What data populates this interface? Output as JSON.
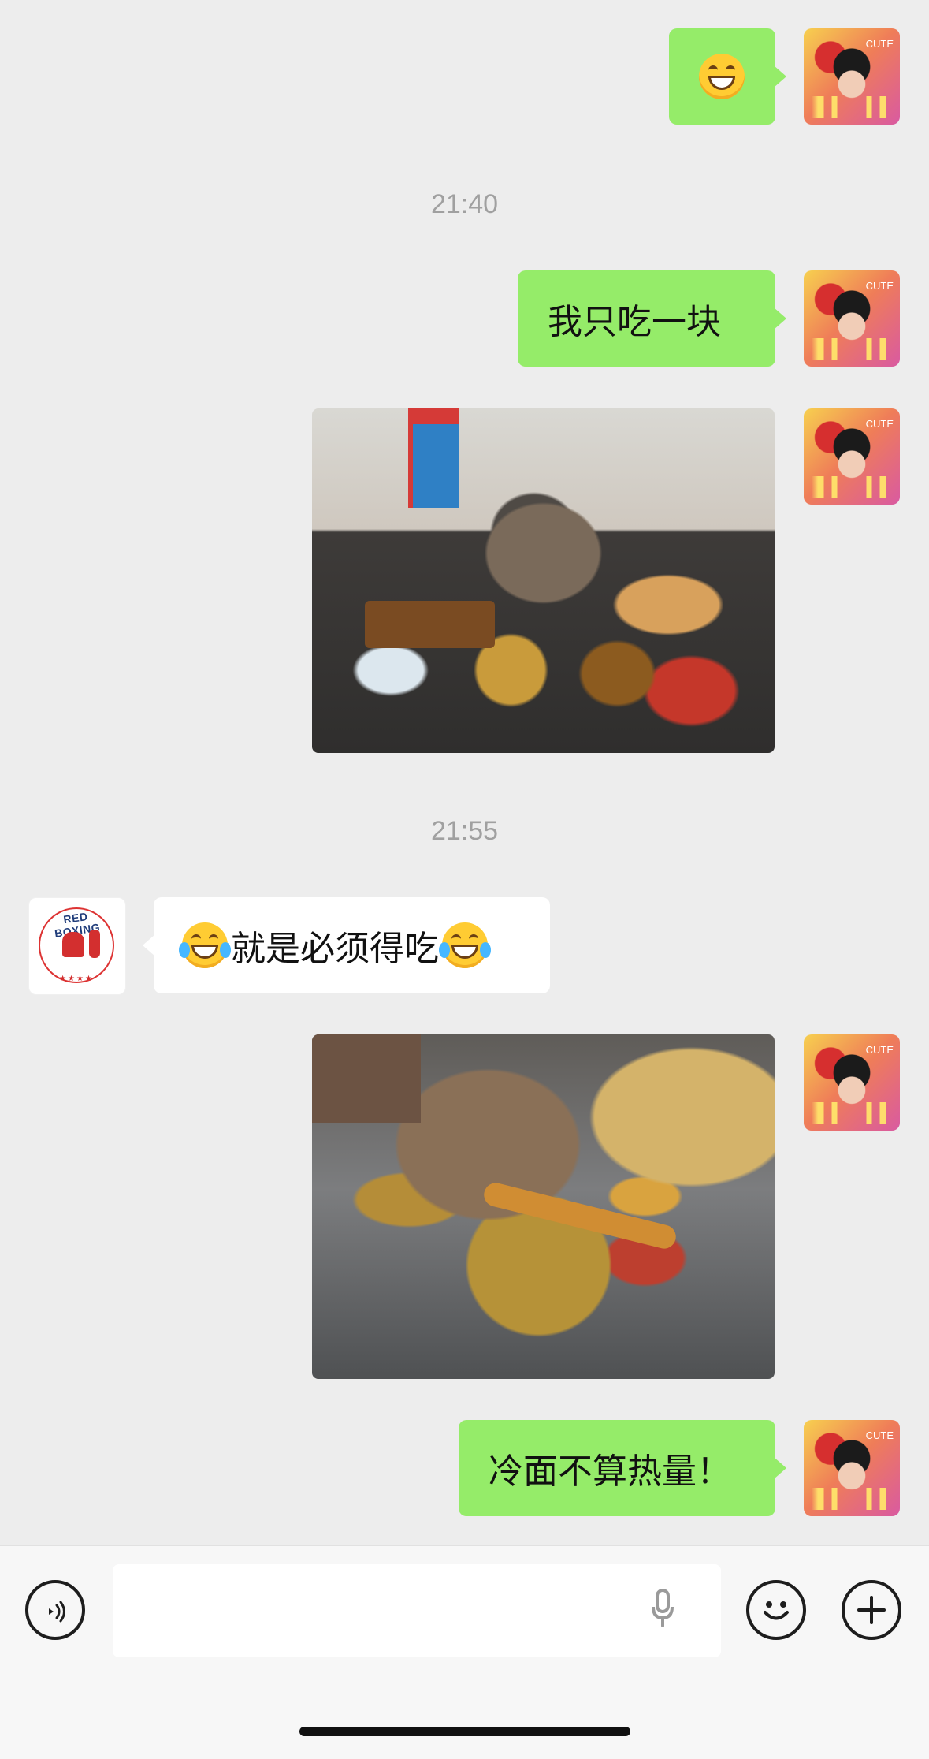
{
  "messages": {
    "m1_icon": "grin-emoji-icon",
    "t1": "21:40",
    "m2": "我只吃一块",
    "t2": "21:55",
    "m3_text": "就是必须得吃",
    "m4": "冷面不算热量！"
  },
  "contacts": {
    "other_logo_text": "RED BOXING",
    "other_logo_stars": "★★★★"
  },
  "composer": {
    "voice_icon": "voice-icon",
    "mic_icon": "microphone-icon",
    "emoji_icon": "emoji-icon",
    "plus_icon": "plus-icon"
  },
  "colors": {
    "chat_bg": "#ededed",
    "my_bubble": "#95ec69",
    "other_bubble": "#ffffff",
    "timestamp": "#a0a0a0"
  }
}
